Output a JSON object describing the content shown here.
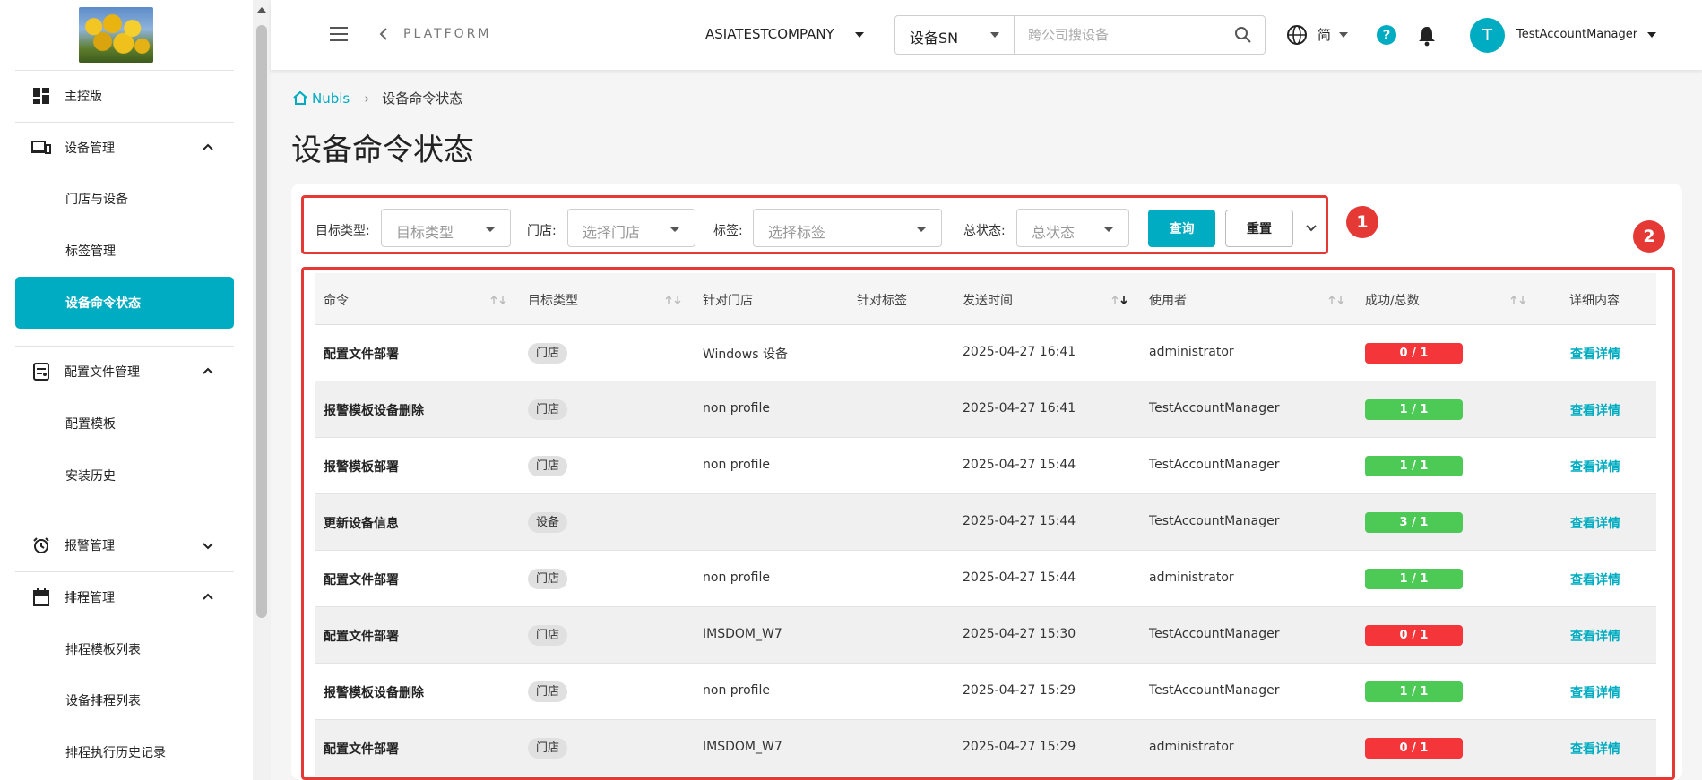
{
  "app": {
    "platform_label": "PLATFORM",
    "company": "ASIATESTCOMPANY",
    "search": {
      "type": "设备SN",
      "placeholder": "跨公司搜设备"
    },
    "language": "简",
    "help": "?",
    "user": {
      "initial": "T",
      "name": "TestAccountManager"
    },
    "accent_color": "#00acc1"
  },
  "sidebar": {
    "groups": [
      {
        "label": "主控版",
        "icon": "dashboard-icon"
      },
      {
        "label": "设备管理",
        "icon": "devices-icon",
        "expanded": true,
        "children": [
          "门店与设备",
          "标签管理",
          "设备命令状态"
        ]
      },
      {
        "label": "配置文件管理",
        "icon": "config-file-icon",
        "expanded": true,
        "children": [
          "配置模板",
          "安装历史"
        ]
      },
      {
        "label": "报警管理",
        "icon": "alarm-clock-icon",
        "expanded": false
      },
      {
        "label": "排程管理",
        "icon": "calendar-icon",
        "expanded": true,
        "children": [
          "排程模板列表",
          "设备排程列表",
          "排程执行历史记录"
        ]
      }
    ],
    "active_item": "设备命令状态"
  },
  "breadcrumb": {
    "home": "Nubis",
    "current": "设备命令状态"
  },
  "page_title": "设备命令状态",
  "filters": {
    "target_type": {
      "label": "目标类型:",
      "placeholder": "目标类型"
    },
    "store": {
      "label": "门店:",
      "placeholder": "选择门店"
    },
    "tag": {
      "label": "标签:",
      "placeholder": "选择标签"
    },
    "status": {
      "label": "总状态:",
      "placeholder": "总状态"
    },
    "query_label": "查询",
    "reset_label": "重置"
  },
  "markers": [
    "1",
    "2"
  ],
  "table": {
    "columns": [
      "命令",
      "目标类型",
      "针对门店",
      "针对标签",
      "发送时间",
      "使用者",
      "成功/总数",
      "详细内容"
    ],
    "rows": [
      {
        "command": "配置文件部署",
        "target": "门店",
        "store": "Windows 设备",
        "tag": "",
        "time": "2025-04-27 16:41",
        "user": "administrator",
        "ratio": "0 / 1",
        "status": "fail",
        "detail": "查看详情"
      },
      {
        "command": "报警模板设备删除",
        "target": "门店",
        "store": "non profile",
        "tag": "",
        "time": "2025-04-27 16:41",
        "user": "TestAccountManager",
        "ratio": "1 / 1",
        "status": "ok",
        "detail": "查看详情"
      },
      {
        "command": "报警模板部署",
        "target": "门店",
        "store": "non profile",
        "tag": "",
        "time": "2025-04-27 15:44",
        "user": "TestAccountManager",
        "ratio": "1 / 1",
        "status": "ok",
        "detail": "查看详情"
      },
      {
        "command": "更新设备信息",
        "target": "设备",
        "store": "",
        "tag": "",
        "time": "2025-04-27 15:44",
        "user": "TestAccountManager",
        "ratio": "3 / 1",
        "status": "ok",
        "detail": "查看详情"
      },
      {
        "command": "配置文件部署",
        "target": "门店",
        "store": "non profile",
        "tag": "",
        "time": "2025-04-27 15:44",
        "user": "administrator",
        "ratio": "1 / 1",
        "status": "ok",
        "detail": "查看详情"
      },
      {
        "command": "配置文件部署",
        "target": "门店",
        "store": "IMSDOM_W7",
        "tag": "",
        "time": "2025-04-27 15:30",
        "user": "TestAccountManager",
        "ratio": "0 / 1",
        "status": "fail",
        "detail": "查看详情"
      },
      {
        "command": "报警模板设备删除",
        "target": "门店",
        "store": "non profile",
        "tag": "",
        "time": "2025-04-27 15:29",
        "user": "TestAccountManager",
        "ratio": "1 / 1",
        "status": "ok",
        "detail": "查看详情"
      },
      {
        "command": "配置文件部署",
        "target": "门店",
        "store": "IMSDOM_W7",
        "tag": "",
        "time": "2025-04-27 15:29",
        "user": "administrator",
        "ratio": "0 / 1",
        "status": "fail",
        "detail": "查看详情"
      }
    ],
    "status_colors": {
      "ok": "#4cca55",
      "fail": "#f4363a"
    }
  }
}
